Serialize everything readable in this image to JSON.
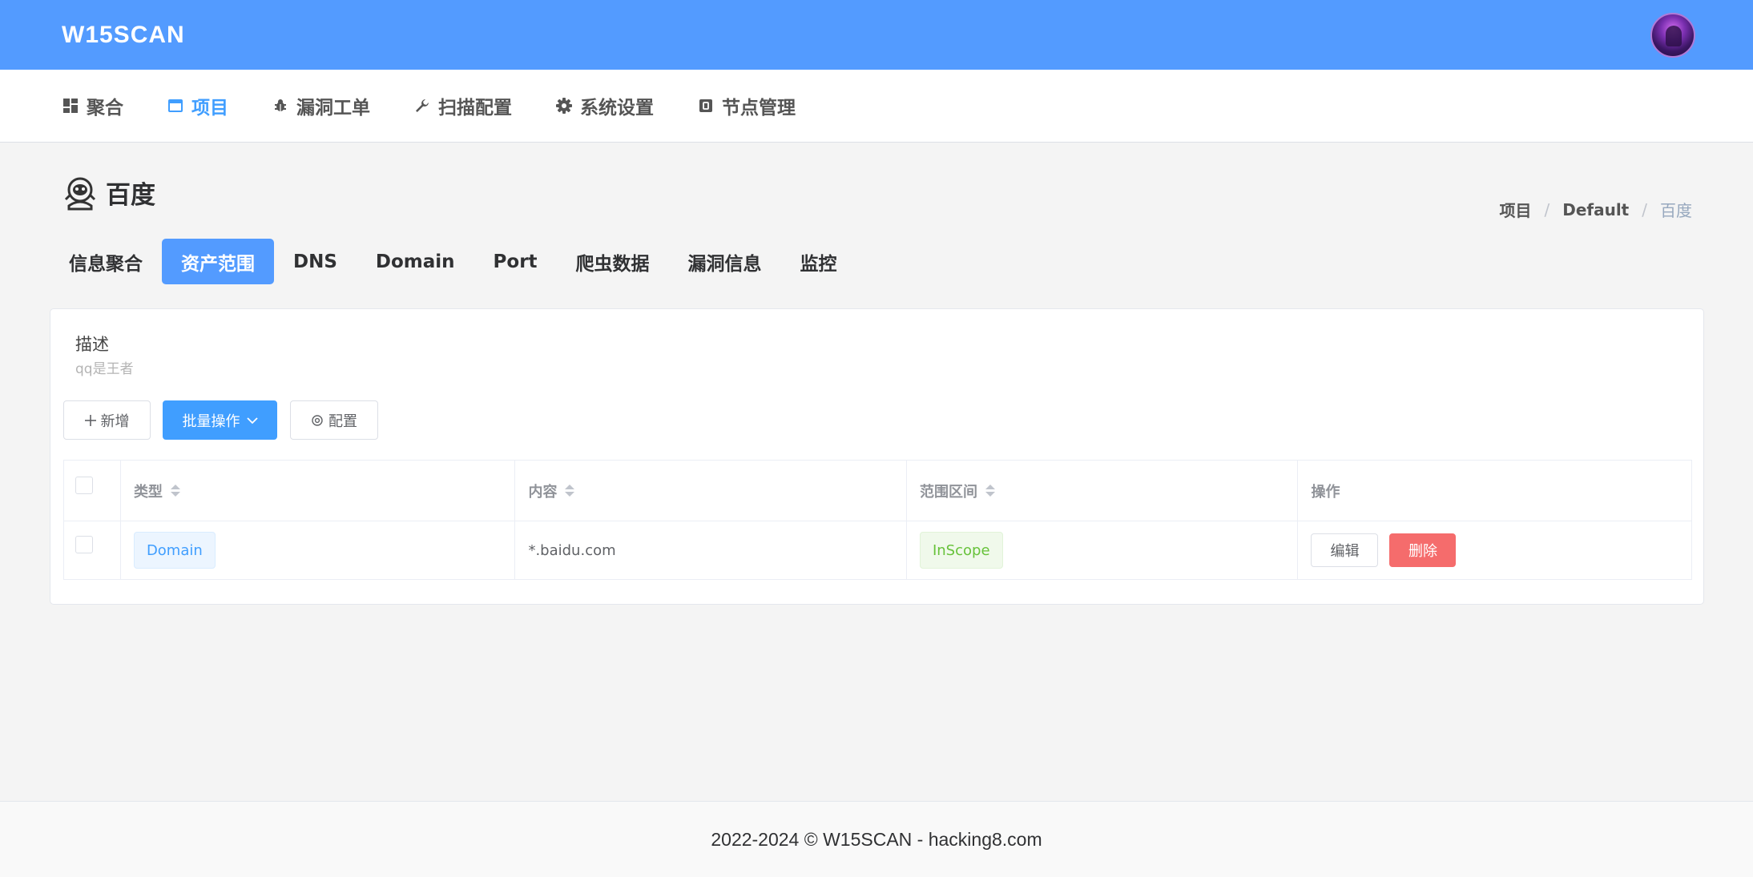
{
  "header": {
    "brand": "W15SCAN",
    "avatar_icon": "avatar-icon"
  },
  "nav": {
    "items": [
      {
        "label": "聚合",
        "icon": "dashboard-icon"
      },
      {
        "label": "项目",
        "icon": "window-icon"
      },
      {
        "label": "漏洞工单",
        "icon": "bug-icon"
      },
      {
        "label": "扫描配置",
        "icon": "wrench-icon"
      },
      {
        "label": "系统设置",
        "icon": "gear-icon"
      },
      {
        "label": "节点管理",
        "icon": "node-icon"
      }
    ],
    "active": "项目"
  },
  "page": {
    "title": "百度",
    "title_icon": "astronaut-icon"
  },
  "breadcrumb": [
    "项目",
    "Default",
    "百度"
  ],
  "tabs": {
    "items": [
      "信息聚合",
      "资产范围",
      "DNS",
      "Domain",
      "Port",
      "爬虫数据",
      "漏洞信息",
      "监控"
    ],
    "active": "资产范围"
  },
  "card": {
    "desc_label": "描述",
    "desc_value": "qq是王者",
    "buttons": {
      "add": "新增",
      "batch": "批量操作",
      "config": "配置"
    }
  },
  "table": {
    "headers": [
      "类型",
      "内容",
      "范围区间",
      "操作"
    ],
    "rows": [
      {
        "type": "Domain",
        "content": "*.baidu.com",
        "scope": "InScope",
        "edit": "编辑",
        "delete": "删除"
      }
    ]
  },
  "footer": {
    "text": "2022-2024 © W15SCAN - hacking8.com"
  },
  "colors": {
    "primary": "#539bff",
    "link": "#409eff",
    "danger": "#f56c6c",
    "success": "#67c23a"
  }
}
